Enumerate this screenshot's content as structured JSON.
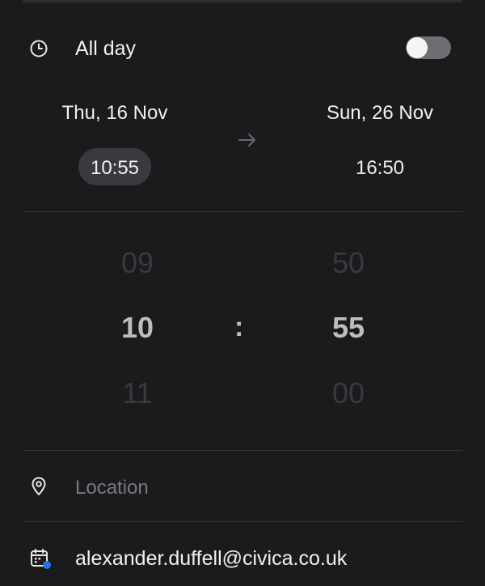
{
  "all_day": {
    "label": "All day",
    "toggle_on": false,
    "icon": "clock-icon"
  },
  "start": {
    "date": "Thu, 16 Nov",
    "time": "10:55"
  },
  "end": {
    "date": "Sun, 26 Nov",
    "time": "16:50"
  },
  "arrow_icon": "arrow-right-icon",
  "time_picker": {
    "hours": {
      "prev": "09",
      "selected": "10",
      "next": "11"
    },
    "separator": ":",
    "minutes": {
      "prev": "50",
      "selected": "55",
      "next": "00"
    }
  },
  "location": {
    "placeholder": "Location",
    "value": "",
    "icon": "location-pin-icon"
  },
  "calendar": {
    "account": "alexander.duffell@civica.co.uk",
    "icon": "calendar-icon",
    "accent_color": "#1f7ae0"
  },
  "colors": {
    "background": "#1b1a1d",
    "chip": "#3a393d",
    "toggle_track": "#6e6d72"
  }
}
